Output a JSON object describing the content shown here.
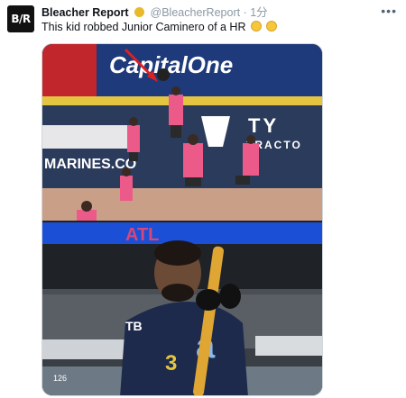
{
  "tweet": {
    "account_name": "Bleacher Report",
    "handle": "@BleacherReport",
    "separator": "·",
    "time": "1分",
    "text": "This kid robbed Junior Caminero of a HR",
    "avatar_text": "B/R",
    "more_icon": "ellipsis-icon"
  },
  "media": {
    "photo1": {
      "sign_main": "CapitalOne",
      "wall_brand": "TY",
      "wall_sub": "TRACTO",
      "wall_url": "MARINES.CO"
    },
    "photo2": {
      "scoreboard_text": "ATL",
      "jersey_logo": "TB",
      "jersey_number": "3",
      "jersey_letter": "a",
      "counter": "126"
    }
  },
  "colors": {
    "verified": "#e8b92a",
    "pink_shirt": "#ec5a8a",
    "wall_navy": "#1f2f57",
    "jersey_navy": "#1d2a4b"
  }
}
